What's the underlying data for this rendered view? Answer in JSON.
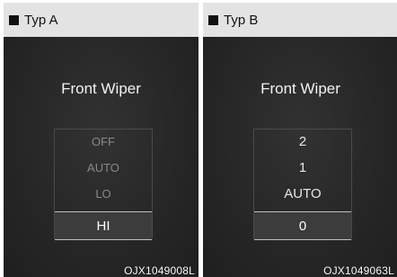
{
  "panels": [
    {
      "header": "Typ A",
      "title": "Front Wiper",
      "options": [
        "OFF",
        "AUTO",
        "LO"
      ],
      "selected": "HI",
      "code": "OJX1049008L"
    },
    {
      "header": "Typ B",
      "title": "Front Wiper",
      "options": [
        "2",
        "1",
        "AUTO"
      ],
      "selected": "0",
      "code": "OJX1049063L"
    }
  ]
}
